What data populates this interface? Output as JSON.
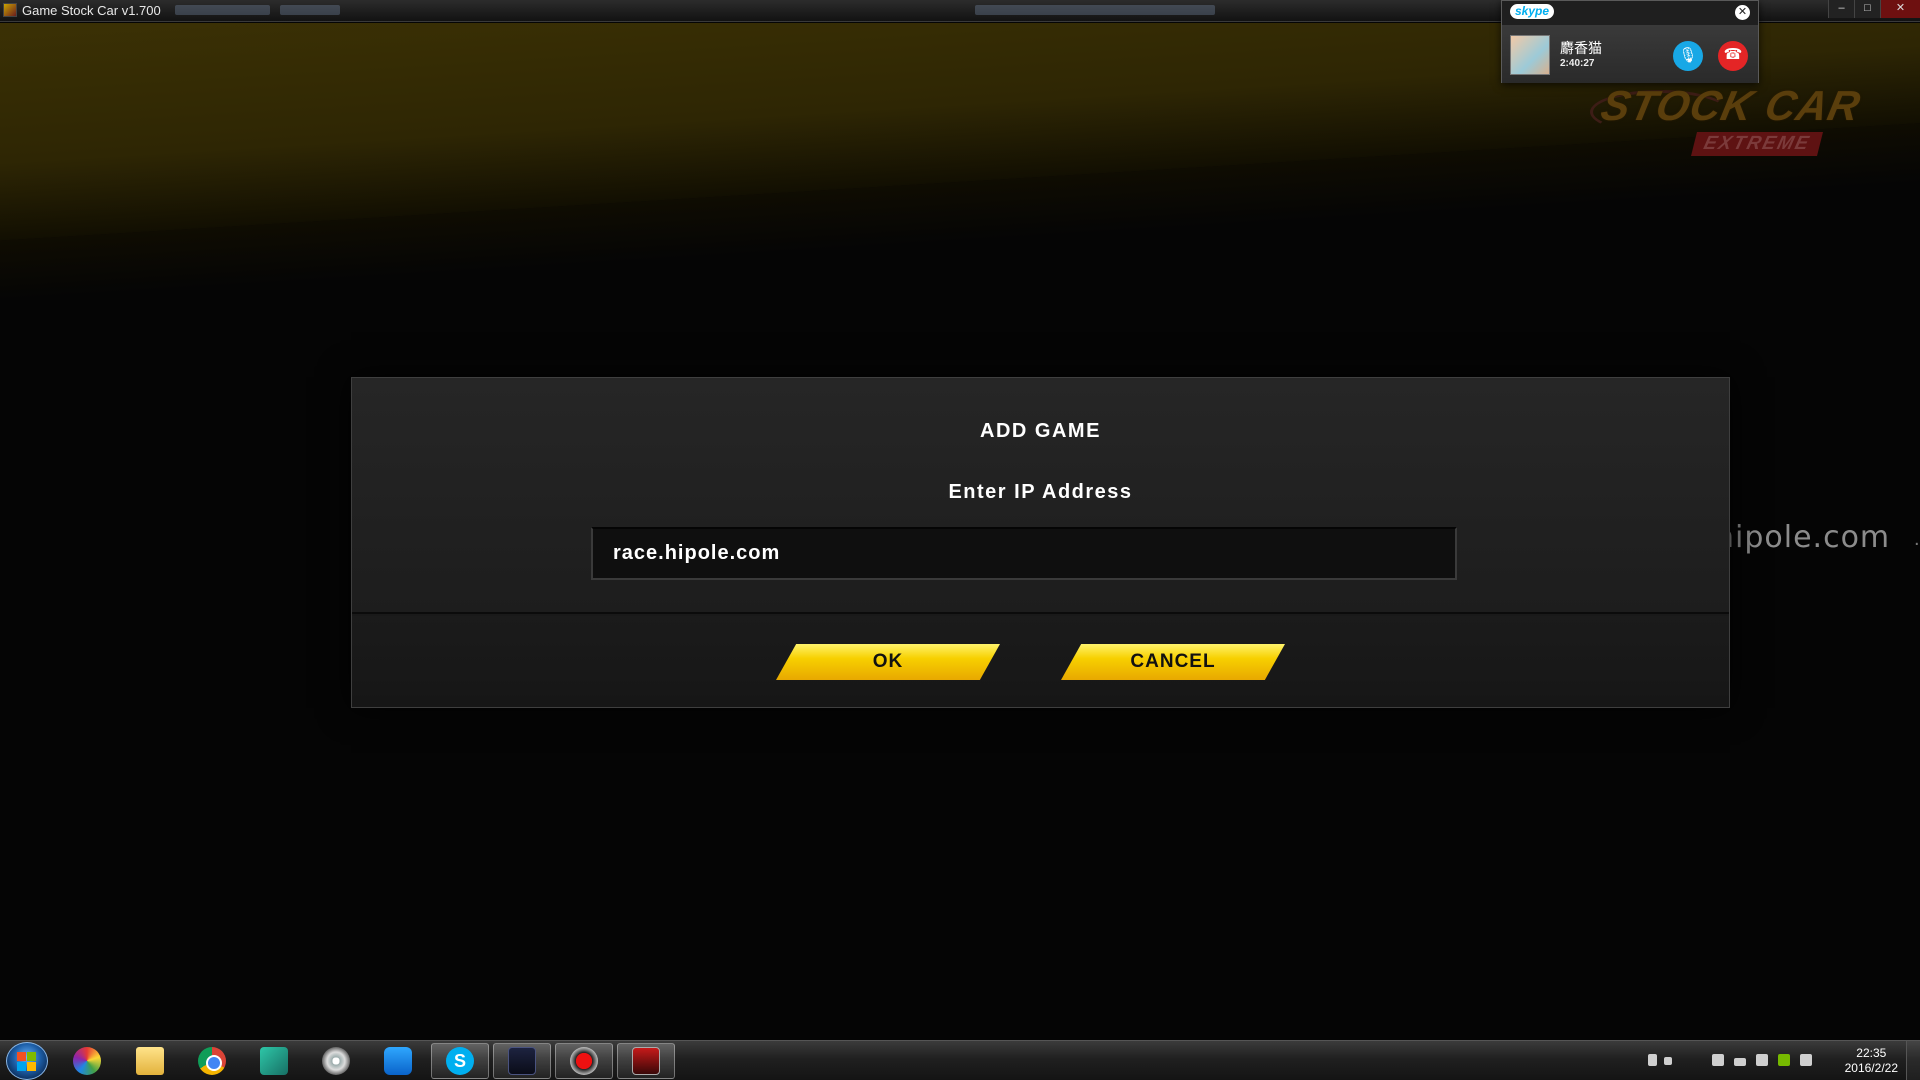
{
  "window": {
    "title": "Game Stock Car v1.700",
    "controls": {
      "minimize": "–",
      "maximize": "□",
      "close": "✕"
    }
  },
  "logo": {
    "main": "STOCK CAR",
    "sub": "EXTREME"
  },
  "skype_call": {
    "brand": "skype",
    "close_icon": "✕",
    "contact_name": "麝香猫",
    "call_duration": "2:40:27",
    "mic_icon": "🎙",
    "hangup_icon": "☎"
  },
  "watermark": {
    "text": "hipole.com",
    "trailing": "."
  },
  "dialog": {
    "title": "ADD GAME",
    "prompt": "Enter IP Address",
    "ip_value": "race.hipole.com",
    "ok_label": "OK",
    "cancel_label": "CANCEL"
  },
  "taskbar": {
    "items": [
      {
        "icon": "color-wheel-icon"
      },
      {
        "icon": "file-explorer-icon"
      },
      {
        "icon": "chrome-icon"
      },
      {
        "icon": "green-app-icon"
      },
      {
        "icon": "film-reel-icon"
      },
      {
        "icon": "blue-app-icon"
      },
      {
        "icon": "skype-icon",
        "glyph": "S"
      },
      {
        "icon": "nvidia-app-icon"
      },
      {
        "icon": "recorder-icon"
      },
      {
        "icon": "stock-car-game-icon"
      }
    ],
    "clock": {
      "time": "22:35",
      "date": "2016/2/22"
    }
  }
}
